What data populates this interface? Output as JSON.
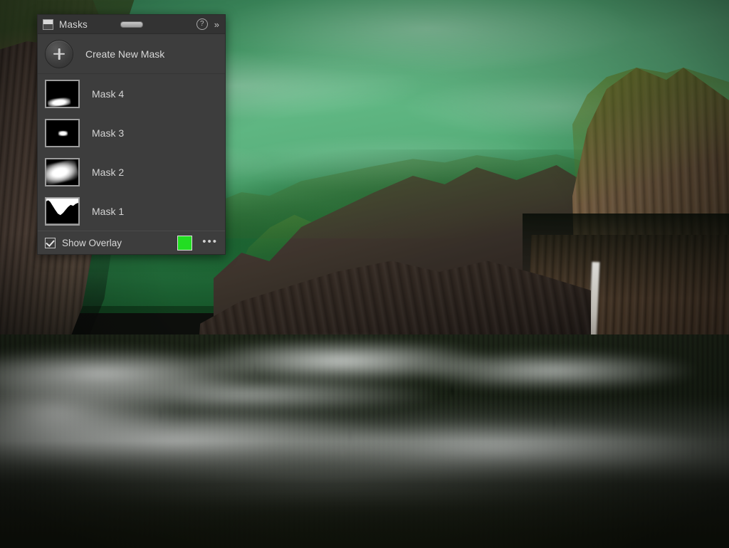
{
  "app": {
    "photo_description": "Yosemite Valley Tunnel View with fog, green mask overlay on sky"
  },
  "panel": {
    "title": "Masks",
    "panel_icon": "panel-square-icon",
    "drag_handle": "drag-handle",
    "help_icon": "?",
    "collapse_icon": "»",
    "create": {
      "label": "Create New Mask",
      "icon": "plus-icon"
    },
    "masks": [
      {
        "label": "Mask 4",
        "thumb": "gradient-bottom-left"
      },
      {
        "label": "Mask 3",
        "thumb": "small-ellipse-center"
      },
      {
        "label": "Mask 2",
        "thumb": "large-diagonal-gradient"
      },
      {
        "label": "Mask 1",
        "thumb": "sky-above-mountain"
      }
    ],
    "footer": {
      "show_overlay_label": "Show Overlay",
      "show_overlay_checked": true,
      "overlay_color": "#22DD22",
      "more_options_label": "•••"
    }
  },
  "colors": {
    "panel_bg": "#3D3D3D",
    "panel_header_bg": "#333333",
    "text": "#D6D6D6",
    "overlay_green": "#22DD22",
    "sky_overlay": "#4FAE75"
  }
}
